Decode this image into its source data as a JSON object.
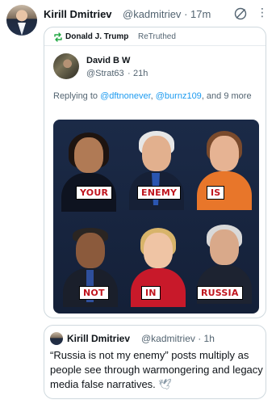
{
  "post": {
    "author_name": "Kirill Dmitriev",
    "author_handle": "@kadmitriev",
    "time": "· 17m",
    "more_label": "⋮"
  },
  "retruth": {
    "name": "Donald J. Trump",
    "label": "ReTruthed"
  },
  "inner_post": {
    "name": "David B W",
    "handle": "@Strat63",
    "dot": "·",
    "time": "21h",
    "reply_prefix": "Replying to ",
    "reply_user_1": "@dftnonever",
    "reply_sep": ", ",
    "reply_user_2": "@burnz109",
    "reply_suffix": ", and 9 more"
  },
  "meme": {
    "words": [
      "YOUR",
      "ENEMY",
      "IS",
      "NOT",
      "IN",
      "RUSSIA"
    ]
  },
  "quote": {
    "name": "Kirill Dmitriev",
    "handle": "@kadmitriev",
    "time": "· 1h",
    "text": "“Russia is not my enemy” posts multiply as people see through warmongering and legacy media false narratives.",
    "emoji": "🕊"
  },
  "colors": {
    "link": "#1d9bf0",
    "muted": "#536471",
    "meme_word": "#c0151e",
    "retruth_icon": "#22a844"
  }
}
